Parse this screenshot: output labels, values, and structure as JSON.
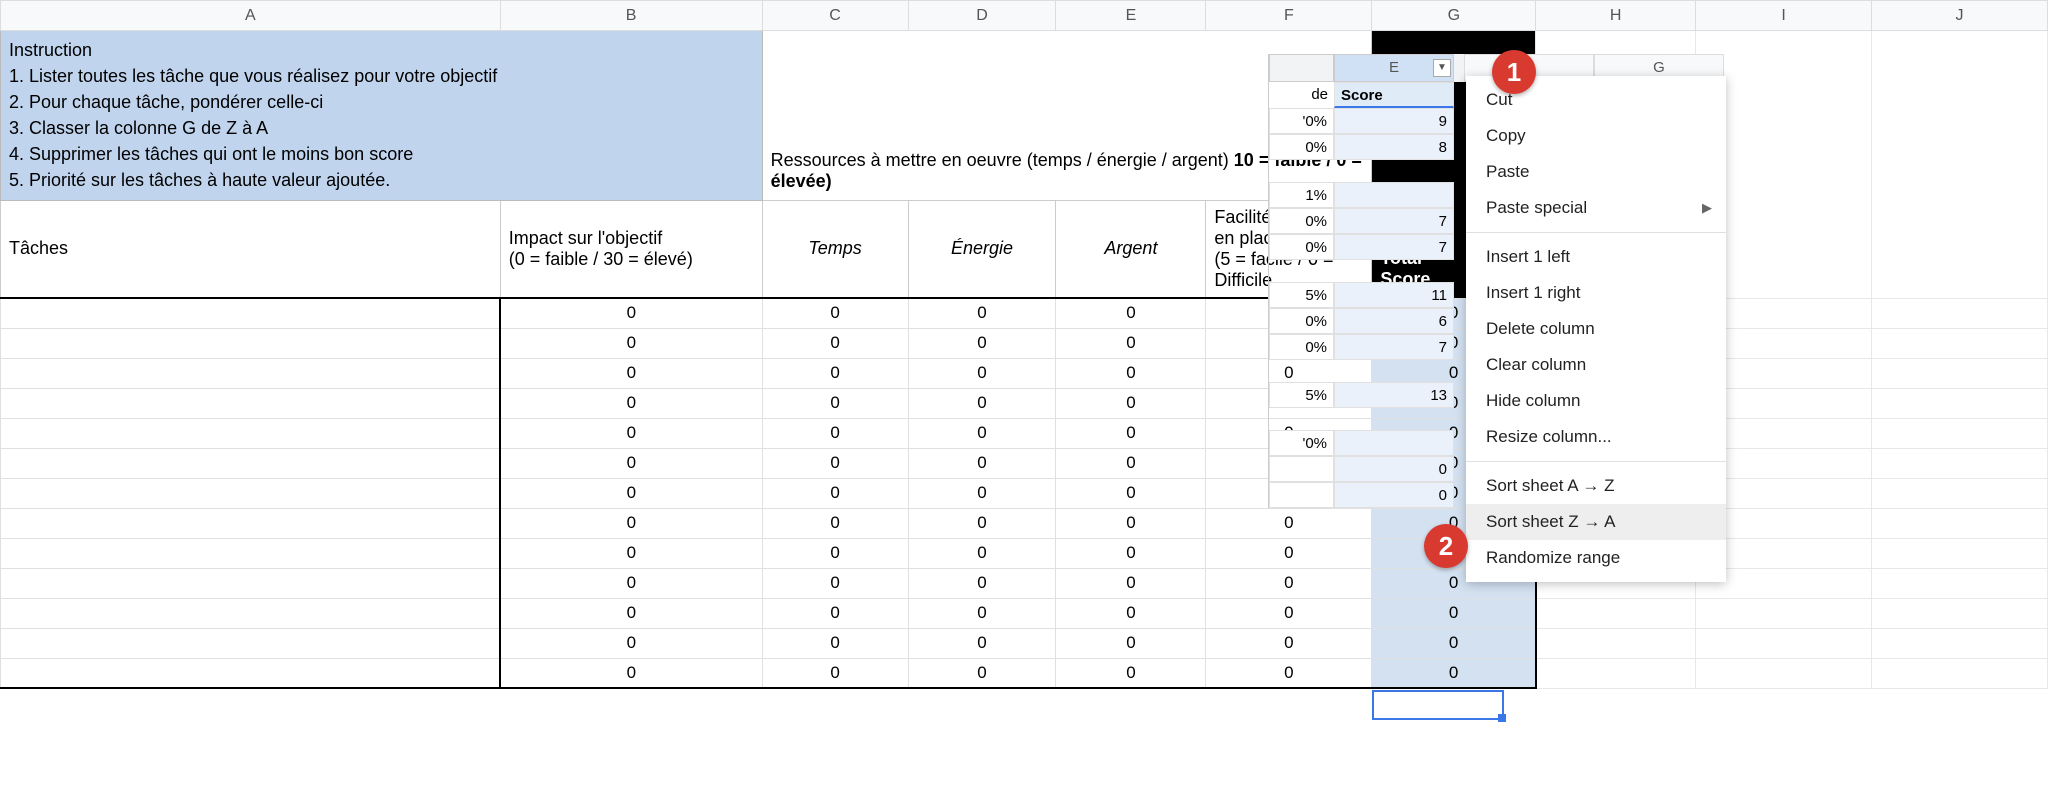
{
  "columns": [
    "A",
    "B",
    "C",
    "D",
    "E",
    "F",
    "G",
    "H",
    "I",
    "J"
  ],
  "instruction": {
    "title": "Instruction",
    "lines": [
      "1. Lister toutes les tâche que vous réalisez pour votre objectif",
      "2. Pour chaque tâche, pondérer celle-ci",
      "3. Classer la colonne G de Z à A",
      "4. Supprimer les tâches qui ont le moins bon score",
      "5. Priorité sur les tâches à haute valeur ajoutée."
    ]
  },
  "resources_heading": {
    "prefix": "Ressources à mettre en oeuvre (temps / énergie / argent) ",
    "bold": "10 = faible / 0 = élevée)"
  },
  "total_heading": {
    "l1": "Total",
    "l2": "Score"
  },
  "headers2": {
    "taches": "Tâches",
    "impact": {
      "l1": "Impact sur l'objectif",
      "l2": "(0 = faible / 30 = élevé)"
    },
    "temps": "Temps",
    "energie": "Énergie",
    "argent": "Argent",
    "facilite": {
      "l1": "Facilité à mettre",
      "l2": "en place",
      "l3": "(5 = facile / 0 =",
      "l4": "Difficile"
    }
  },
  "data_row": {
    "A": "",
    "B": "0",
    "C": "0",
    "D": "0",
    "E": "0",
    "F": "0",
    "G": "0"
  },
  "data_row_count": 13,
  "inset": {
    "colE": "E",
    "score_label": "Score",
    "de_suffix": "de",
    "groups": [
      [
        {
          "pct": "'0%",
          "score": "9"
        },
        {
          "pct": "0%",
          "score": "8"
        }
      ],
      [
        {
          "pct": "1%",
          "score": ""
        },
        {
          "pct": "0%",
          "score": "7"
        },
        {
          "pct": "0%",
          "score": "7"
        }
      ],
      [
        {
          "pct": "5%",
          "score": "11"
        },
        {
          "pct": "0%",
          "score": "6"
        },
        {
          "pct": "0%",
          "score": "7"
        }
      ],
      [
        {
          "pct": "5%",
          "score": "13"
        }
      ],
      [
        {
          "pct": "'0%",
          "score": ""
        },
        {
          "pct": "",
          "score": "0"
        },
        {
          "pct": "",
          "score": "0"
        }
      ]
    ]
  },
  "context_menu": {
    "col_headers_right": [
      "F",
      "G"
    ],
    "items": [
      {
        "label": "Cut",
        "type": "item"
      },
      {
        "label": "Copy",
        "type": "item"
      },
      {
        "label": "Paste",
        "type": "item"
      },
      {
        "label": "Paste special",
        "type": "submenu"
      },
      {
        "type": "sep"
      },
      {
        "label": "Insert 1 left",
        "type": "item"
      },
      {
        "label": "Insert 1 right",
        "type": "item"
      },
      {
        "label": "Delete column",
        "type": "item"
      },
      {
        "label": "Clear column",
        "type": "item"
      },
      {
        "label": "Hide column",
        "type": "item"
      },
      {
        "label": "Resize column...",
        "type": "item"
      },
      {
        "type": "sep"
      },
      {
        "label": "Sort sheet A → Z",
        "type": "item"
      },
      {
        "label": "Sort sheet Z → A",
        "type": "item",
        "hover": true
      },
      {
        "label": "Randomize range",
        "type": "item"
      }
    ]
  },
  "badges": {
    "b1": "1",
    "b2": "2"
  }
}
